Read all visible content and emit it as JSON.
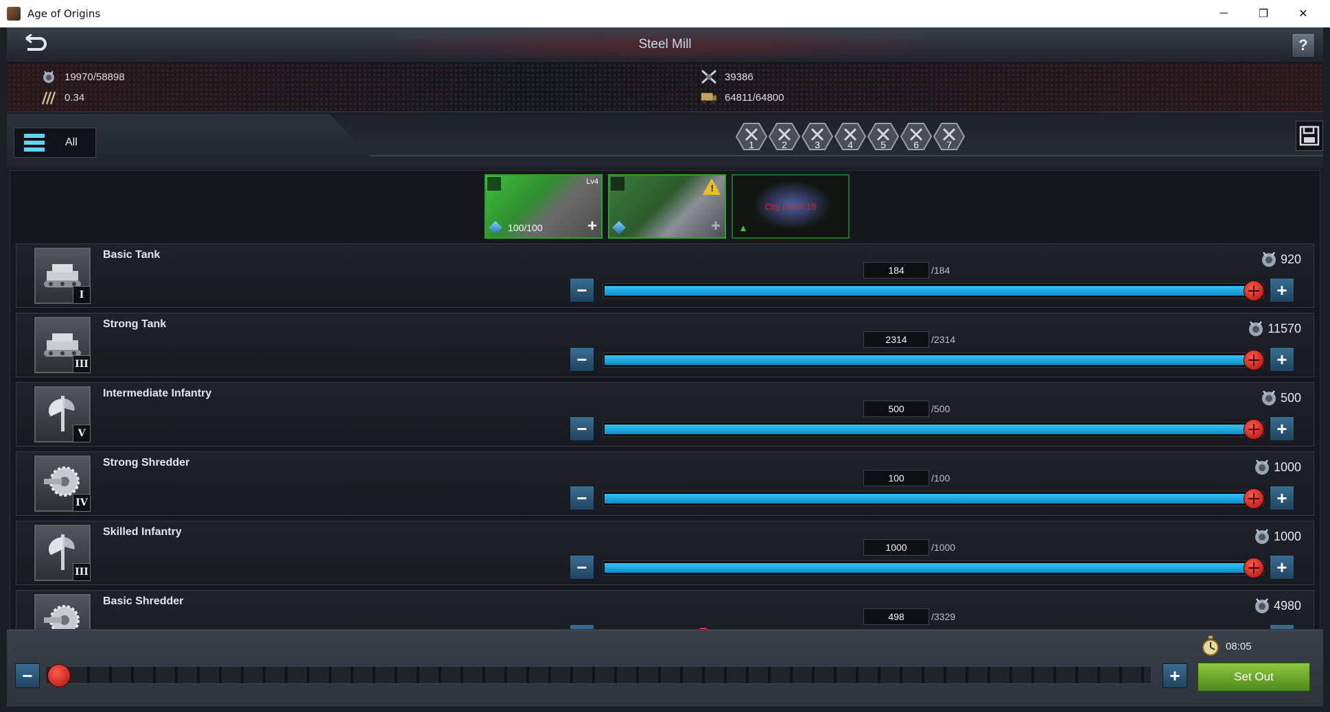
{
  "window": {
    "title": "Age of Origins",
    "controls": [
      "─",
      "❐",
      "✕"
    ]
  },
  "header": {
    "title": "Steel Mill",
    "back_icon": "back-arrow-icon",
    "help_label": "?"
  },
  "stats": {
    "load": "19970/58898",
    "speed": "0.34",
    "power": "39386",
    "capacity": "64811/64800"
  },
  "filter": {
    "label": "All",
    "presets": [
      "1",
      "2",
      "3",
      "4",
      "5",
      "6",
      "7"
    ]
  },
  "heroes": [
    {
      "level": "Lv4",
      "energy": "100/100",
      "plus": "+"
    },
    {
      "plus": "+"
    },
    {
      "requirement": "City Level 18"
    }
  ],
  "troops": [
    {
      "name": "Basic Tank",
      "tier": "I",
      "value": "184",
      "max": "/184",
      "fraction": 1.0,
      "power": "920",
      "icon": "tank-icon"
    },
    {
      "name": "Strong Tank",
      "tier": "III",
      "value": "2314",
      "max": "/2314",
      "fraction": 1.0,
      "power": "11570",
      "icon": "tank-icon"
    },
    {
      "name": "Intermediate Infantry",
      "tier": "V",
      "value": "500",
      "max": "/500",
      "fraction": 1.0,
      "power": "500",
      "icon": "axe-icon"
    },
    {
      "name": "Strong Shredder",
      "tier": "IV",
      "value": "100",
      "max": "/100",
      "fraction": 1.0,
      "power": "1000",
      "icon": "saw-icon"
    },
    {
      "name": "Skilled Infantry",
      "tier": "III",
      "value": "1000",
      "max": "/1000",
      "fraction": 1.0,
      "power": "1000",
      "icon": "axe-icon"
    },
    {
      "name": "Basic Shredder",
      "tier": "",
      "value": "498",
      "max": "/3329",
      "fraction": 0.15,
      "power": "4980",
      "icon": "saw-icon"
    }
  ],
  "bottom": {
    "march_time": "08:05",
    "set_out_label": "Set Out",
    "slider_fraction": 0.0
  },
  "colors": {
    "slider_fill": "#0a8fc7",
    "thumb": "#c21a1a",
    "set_out": "#6aa82a"
  }
}
